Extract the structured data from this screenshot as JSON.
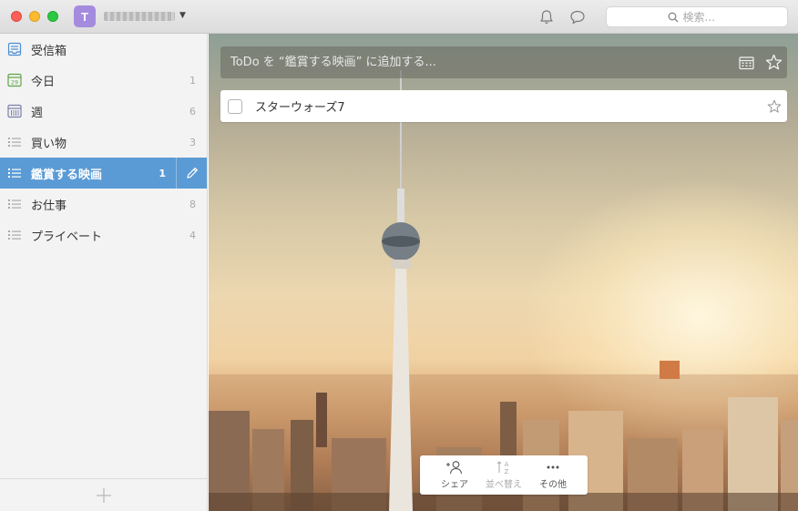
{
  "titlebar": {
    "avatar_initial": "T",
    "notifications_icon": "bell-icon",
    "conversations_icon": "speech-bubble-icon"
  },
  "search": {
    "placeholder": "検索..."
  },
  "sidebar": {
    "items": [
      {
        "label": "受信箱",
        "count": "",
        "icon": "inbox-icon",
        "active": false
      },
      {
        "label": "今日",
        "count": "1",
        "icon": "calendar-today-icon",
        "active": false
      },
      {
        "label": "週",
        "count": "6",
        "icon": "calendar-week-icon",
        "active": false
      },
      {
        "label": "買い物",
        "count": "3",
        "icon": "list-icon",
        "active": false
      },
      {
        "label": "鑑賞する映画",
        "count": "1",
        "icon": "list-icon",
        "active": true
      },
      {
        "label": "お仕事",
        "count": "8",
        "icon": "list-icon",
        "active": false
      },
      {
        "label": "プライベート",
        "count": "4",
        "icon": "list-icon",
        "active": false
      }
    ],
    "today_icon_number": "29",
    "add_list_icon": "plus-icon"
  },
  "main": {
    "add_placeholder": "ToDo を “鑑賞する映画” に追加する...",
    "tasks": [
      {
        "title": "スターウォーズ7",
        "completed": false,
        "starred": false
      }
    ],
    "toolbar": {
      "share_label": "シェア",
      "sort_label": "並べ替え",
      "more_label": "その他"
    }
  },
  "colors": {
    "accent": "#5b9bd5",
    "avatar": "#a48bde",
    "close": "#fc5f57",
    "minimize": "#fdbc2e",
    "maximize": "#29c941"
  }
}
